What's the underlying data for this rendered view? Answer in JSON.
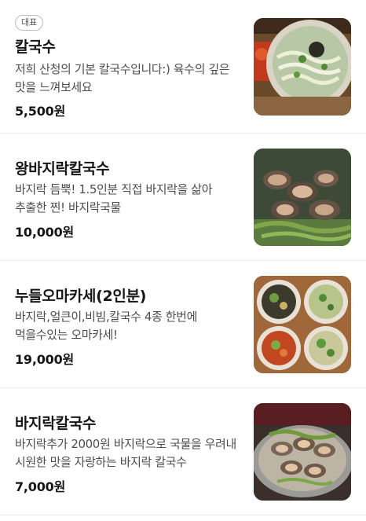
{
  "menu": {
    "items": [
      {
        "badge": "대표",
        "name": "칼국수",
        "description": "저희 산청의 기본 칼국수입니다:) 육수의 깊은 맛을 느껴보세요",
        "price": "5,500원",
        "image_icon": "kalguksu-photo"
      },
      {
        "name": "왕바지락칼국수",
        "description": "바지락 듬뿍! 1.5인분 직접 바지락을 삶아 추출한 찐! 바지락국물",
        "price": "10,000원",
        "image_icon": "clam-kalguksu-photo"
      },
      {
        "name": "누들오마카세(2인분)",
        "description": "바지락,얼큰이,비빔,칼국수 4종 한번에 먹을수있는 오마카세!",
        "price": "19,000원",
        "image_icon": "noodle-omakase-photo"
      },
      {
        "name": "바지락칼국수",
        "description": "바지락추가 2000원 바지락으로 국물을 우려내 시원한 맛을 자랑하는 바지락 칼국수",
        "price": "7,000원",
        "image_icon": "clam-noodle-pot-photo"
      }
    ]
  }
}
